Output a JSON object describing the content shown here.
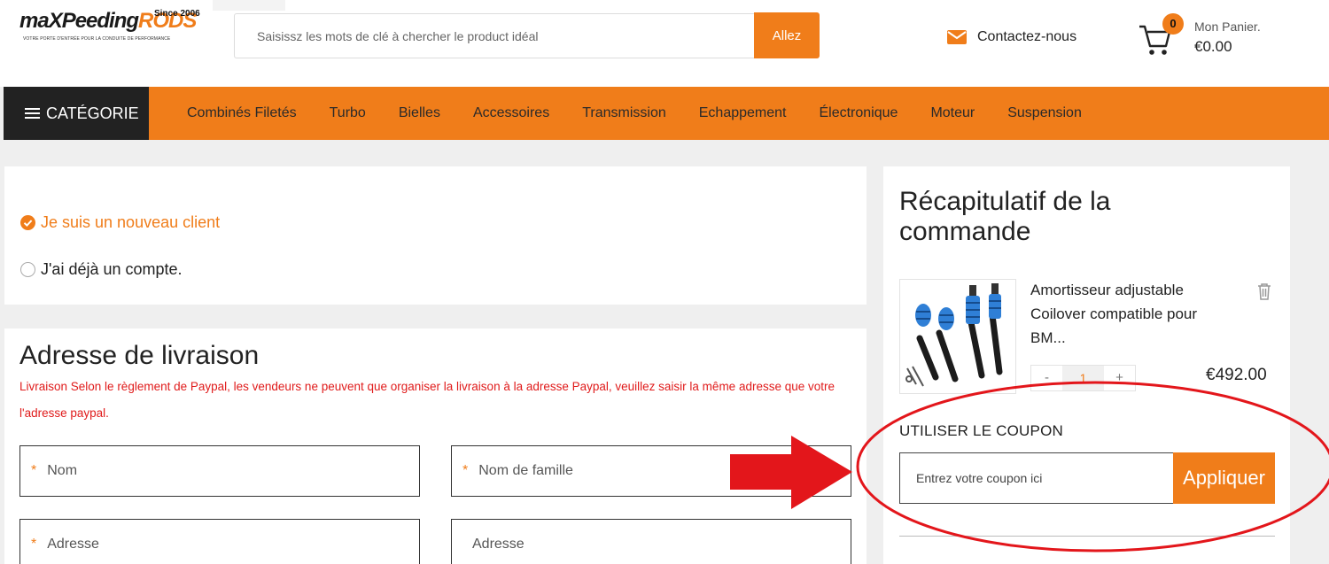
{
  "header": {
    "logo_text_main": "maXPeeding",
    "logo_text_accent": "RODS",
    "logo_since": "Since 2006",
    "logo_tagline": "VOTRE PORTE D'ENTRÉE POUR LA CONDUITE DE PERFORMANCE",
    "search_placeholder": "Saisissz les mots de clé à chercher le product idéal",
    "search_button": "Allez",
    "contact_label": "Contactez-nous",
    "cart_count": "0",
    "cart_title": "Mon Panier.",
    "cart_total": "€0.00"
  },
  "nav": {
    "category_button": "CATÉGORIE",
    "links": [
      "Combinés Filetés",
      "Turbo",
      "Bielles",
      "Accessoires",
      "Transmission",
      "Echappement",
      "Électronique",
      "Moteur",
      "Suspension"
    ]
  },
  "account": {
    "new_client": "Je suis un nouveau client",
    "existing_account": "J'ai déjà un compte."
  },
  "address": {
    "title": "Adresse de livraison",
    "note": "Livraison Selon le règlement de Paypal, les vendeurs ne peuvent que organiser la livraison à la adresse Paypal, veuillez saisir la même adresse que votre l'adresse paypal.",
    "fields": {
      "first_name": "Nom",
      "last_name": "Nom de famille",
      "address1": "Adresse",
      "address2": "Adresse"
    },
    "required_mark": "*"
  },
  "summary": {
    "title": "Récapitulatif de la commande",
    "product_name": "Amortisseur adjustable Coilover compatible pour BM...",
    "qty_minus": "-",
    "qty_value": "1",
    "qty_plus": "+",
    "price": "€492.00",
    "coupon_label": "UTILISER LE COUPON",
    "coupon_placeholder": "Entrez votre coupon ici",
    "coupon_button": "Appliquer"
  },
  "colors": {
    "accent": "#f07d1a",
    "dark": "#222222",
    "note_red": "#e01b1b",
    "annotation_red": "#e3161b"
  },
  "icons": {
    "contact": "envelope-icon",
    "cart": "cart-icon",
    "trash": "trash-icon",
    "menu": "hamburger-icon",
    "checked": "check-circle-icon"
  }
}
